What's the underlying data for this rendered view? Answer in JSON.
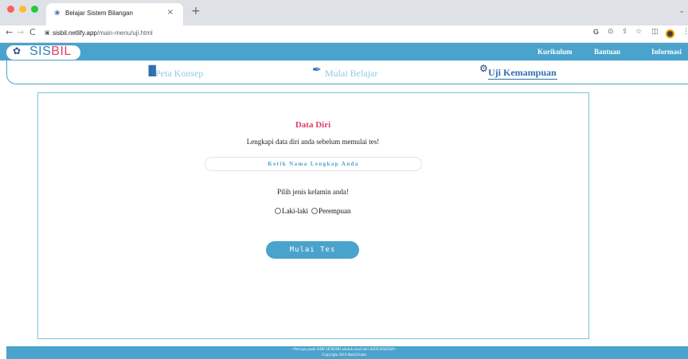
{
  "browser": {
    "tab_title": "Belajar Sistem Bilangan",
    "tab_close": "×",
    "new_tab": "+",
    "url_host": "sisbil.netlify.app",
    "url_path": "/main-menu/uji.html",
    "icons": {
      "back": "←",
      "forward": "→",
      "reload": "C",
      "lock": "🔒",
      "google": "G",
      "lens": "⊙",
      "share": "⇪",
      "star": "☆",
      "sidepanel": "◫",
      "menu": "⋮",
      "caret": "⌄"
    }
  },
  "site": {
    "logo": {
      "sis": "SIS",
      "bil": "BIL",
      "icon": "✿"
    },
    "nav": [
      "Kurikulum",
      "Bantuan",
      "Informasi"
    ],
    "menu": [
      {
        "label": "Peta Konsep",
        "icon": "bar-chart-icon",
        "glyph": "▐▌"
      },
      {
        "label": "Mulai Belajar",
        "icon": "feather-icon",
        "glyph": "✒"
      },
      {
        "label": "Uji Kemampuan",
        "icon": "gear-icon",
        "glyph": "⚙",
        "active": true
      }
    ],
    "accent_color": "#4aa3cc",
    "title_color": "#e23f68"
  },
  "form": {
    "title": "Data Diri",
    "subtitle": "Lengkapi data diri anda sebelum memulai tes!",
    "name_placeholder": "Ketik Nama Lengkap Anda",
    "name_value": "",
    "gender_question": "Pilih jenis kelamin anda!",
    "gender_options": [
      "Laki-laki",
      "Perempuan"
    ],
    "start_label": "Mulai Tes"
  },
  "footer": {
    "quote": "--Percaya pada DIRI SENDIRI adalah awal dari KESUKSESAN--",
    "copyright": "Copyright 2019 BekilUtami"
  }
}
